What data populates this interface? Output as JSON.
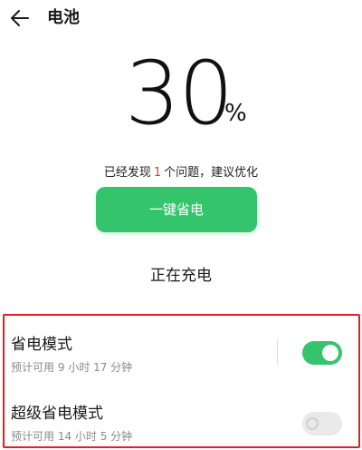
{
  "header": {
    "back_icon": "arrow-left-icon",
    "title": "电池"
  },
  "battery": {
    "level": "30",
    "unit": "%"
  },
  "issues": {
    "prefix": "已经发现",
    "count": "1",
    "suffix": "个问题，建议优化",
    "count_color": "#e03a3a"
  },
  "optimize_button": {
    "label": "一键省电",
    "color": "#34c56c"
  },
  "status": {
    "charging": "正在充电"
  },
  "settings": [
    {
      "title": "省电模式",
      "subtitle": "预计可用 9 小时 17 分钟",
      "enabled": true
    },
    {
      "title": "超级省电模式",
      "subtitle": "预计可用 14 小时 5 分钟",
      "enabled": false
    }
  ],
  "colors": {
    "accent": "#34c56c",
    "highlight_border": "#e02020"
  }
}
